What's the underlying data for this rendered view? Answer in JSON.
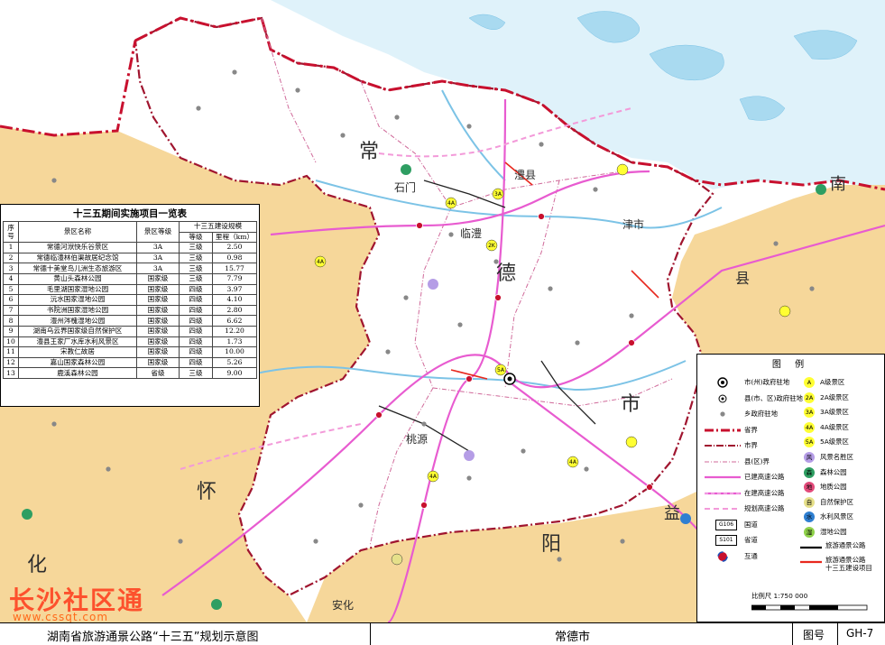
{
  "table": {
    "title": "十三五期间实施项目一览表",
    "headers": {
      "no": "序号",
      "name": "景区名称",
      "grade": "景区等级",
      "scale_group": "十三五建设规模",
      "level": "等级",
      "mileage": "里程（km）"
    },
    "rows": [
      {
        "no": "1",
        "name": "常德河洑快乐谷景区",
        "grade": "3A",
        "level": "三级",
        "mileage": "2.50"
      },
      {
        "no": "2",
        "name": "常德临澧林伯渠故居纪念馆",
        "grade": "3A",
        "level": "三级",
        "mileage": "0.98"
      },
      {
        "no": "3",
        "name": "常德十美堂鸟儿洲生态旅游区",
        "grade": "3A",
        "level": "三级",
        "mileage": "15.77"
      },
      {
        "no": "4",
        "name": "黄山头森林公园",
        "grade": "国家级",
        "level": "三级",
        "mileage": "7.79"
      },
      {
        "no": "5",
        "name": "毛里湖国家湿地公园",
        "grade": "国家级",
        "level": "四级",
        "mileage": "3.97"
      },
      {
        "no": "6",
        "name": "沅水国家湿地公园",
        "grade": "国家级",
        "level": "四级",
        "mileage": "4.10"
      },
      {
        "no": "7",
        "name": "书院洲国家湿地公园",
        "grade": "国家级",
        "level": "四级",
        "mileage": "2.80"
      },
      {
        "no": "8",
        "name": "澧州涔槐湿地公园",
        "grade": "国家级",
        "level": "四级",
        "mileage": "6.62"
      },
      {
        "no": "9",
        "name": "湖南乌云界国家级自然保护区",
        "grade": "国家级",
        "level": "四级",
        "mileage": "12.20"
      },
      {
        "no": "10",
        "name": "澧县王家厂水库水利风景区",
        "grade": "国家级",
        "level": "四级",
        "mileage": "1.73"
      },
      {
        "no": "11",
        "name": "宋教仁故居",
        "grade": "国家级",
        "level": "四级",
        "mileage": "10.00"
      },
      {
        "no": "12",
        "name": "嘉山国家森林公园",
        "grade": "国家级",
        "level": "四级",
        "mileage": "5.26"
      },
      {
        "no": "13",
        "name": "鹿溪森林公园",
        "grade": "省级",
        "level": "三级",
        "mileage": "9.00"
      }
    ]
  },
  "legend": {
    "title": "图 例",
    "left_items": [
      {
        "label": "市(州)政府驻地"
      },
      {
        "label": "县(市、区)政府驻地"
      },
      {
        "label": "乡政府驻地"
      },
      {
        "label": "省界"
      },
      {
        "label": "市界"
      },
      {
        "label": "县(区)界"
      },
      {
        "label": "已建高速公路"
      },
      {
        "label": "在建高速公路"
      },
      {
        "label": "规划高速公路"
      },
      {
        "label": "国道",
        "tag": "G106"
      },
      {
        "label": "省道",
        "tag": "S101"
      },
      {
        "label": "互通"
      }
    ],
    "right_items": [
      {
        "badge": "A",
        "label": "A级景区",
        "color": "#ffff33"
      },
      {
        "badge": "2A",
        "label": "2A级景区",
        "color": "#ffff33"
      },
      {
        "badge": "3A",
        "label": "3A级景区",
        "color": "#ffff33"
      },
      {
        "badge": "4A",
        "label": "4A级景区",
        "color": "#ffff33"
      },
      {
        "badge": "5A",
        "label": "5A级景区",
        "color": "#ffff33"
      },
      {
        "badge": "风",
        "label": "风景名胜区",
        "color": "#b59de6"
      },
      {
        "badge": "森",
        "label": "森林公园",
        "color": "#2e9e62"
      },
      {
        "badge": "地",
        "label": "地质公园",
        "color": "#e24a7a"
      },
      {
        "badge": "自",
        "label": "自然保护区",
        "color": "#e6e08a"
      },
      {
        "badge": "水",
        "label": "水利风景区",
        "color": "#2f7fd1"
      },
      {
        "badge": "湿",
        "label": "湿地公园",
        "color": "#8fd14a"
      },
      {
        "label": "旅游通景公路"
      },
      {
        "label": "旅游通景公路\n十三五建设项目"
      }
    ],
    "scale": "比例尺 1:750 000"
  },
  "title_bar": {
    "title": "湖南省旅游通景公路“十三五”规划示意图",
    "city": "常德市",
    "fig_label": "图号",
    "fig_no": "GH-7"
  },
  "watermark": {
    "text": "长沙社区通",
    "url": "www.cssqt.com"
  },
  "map_labels": {
    "chang": "常",
    "de": "德",
    "shi": "市",
    "huai": "怀",
    "hua": "化",
    "yi": "益",
    "yang": "阳",
    "nan": "南",
    "xian": "县",
    "shimen": "石门",
    "linli": "临澧",
    "lixian": "澧县",
    "taoyuan": "桃源",
    "anhua": "安化",
    "jinshi": "津市"
  },
  "colors": {
    "water": "#a9daf0",
    "outer_land": "#f6d79a",
    "city_land": "#ffffff",
    "province_border": "#c8102e",
    "city_border": "#a0152f",
    "highway_built": "#e85bd0",
    "highway_planned": "#f39ad9",
    "project_road": "#e8281d",
    "tourist_road": "#000000"
  }
}
